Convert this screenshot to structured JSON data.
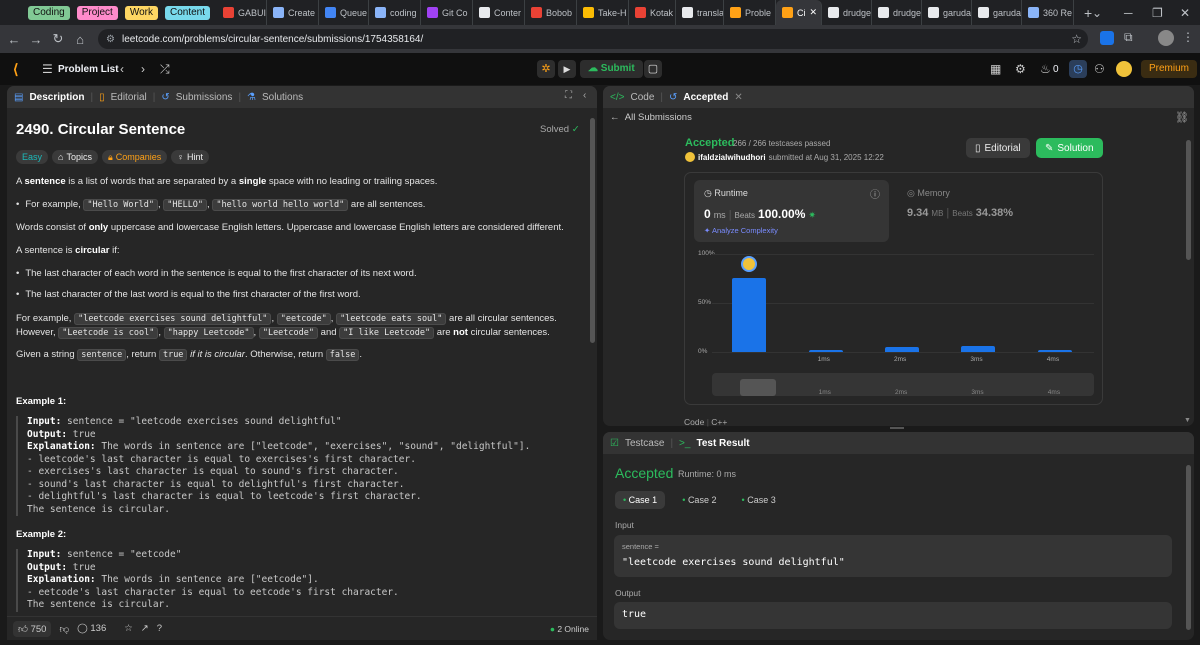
{
  "tab_groups": [
    {
      "label": "Coding",
      "color": "#81c995"
    },
    {
      "label": "Project",
      "color": "#ff8bcb"
    },
    {
      "label": "Work",
      "color": "#fdd663"
    },
    {
      "label": "Content",
      "color": "#78d9ec"
    }
  ],
  "tabs": [
    {
      "label": "GABUI",
      "icon": "gmail-icon",
      "color": "#e94235"
    },
    {
      "label": "Create",
      "icon": "chrome-icon",
      "color": "#8ab4f8"
    },
    {
      "label": "Queue",
      "icon": "queue-icon",
      "color": "#4285f4"
    },
    {
      "label": "coding",
      "icon": "coding-icon",
      "color": "#8ab4f8"
    },
    {
      "label": "Git Co",
      "icon": "heart-icon",
      "color": "#a142f4"
    },
    {
      "label": "Conter",
      "icon": "doc-icon",
      "color": "#e8eaed"
    },
    {
      "label": "Bobob",
      "icon": "gmail-icon",
      "color": "#e94235"
    },
    {
      "label": "Take-H",
      "icon": "drive-icon",
      "color": "#fbbc04"
    },
    {
      "label": "Kotak",
      "icon": "gmail-icon",
      "color": "#e94235"
    },
    {
      "label": "transla",
      "icon": "google-icon",
      "color": "#e8eaed"
    },
    {
      "label": "Proble",
      "icon": "leetcode-icon",
      "color": "#ffa116"
    },
    {
      "label": "Ci",
      "icon": "leetcode-icon",
      "color": "#ffa116"
    },
    {
      "label": "drudge",
      "icon": "github-icon",
      "color": "#e8eaed"
    },
    {
      "label": "drudge",
      "icon": "github-icon",
      "color": "#e8eaed"
    },
    {
      "label": "garuda",
      "icon": "github-icon",
      "color": "#e8eaed"
    },
    {
      "label": "garuda",
      "icon": "github-icon",
      "color": "#e8eaed"
    },
    {
      "label": "360 Re",
      "icon": "calendar-icon",
      "color": "#8ab4f8"
    }
  ],
  "browser": {
    "url": "leetcode.com/problems/circular-sentence/submissions/1754358164/"
  },
  "topbar": {
    "problem_list": "Problem List",
    "submit": "Submit",
    "streak": "0",
    "premium": "Premium"
  },
  "left": {
    "tabs": [
      "Description",
      "Editorial",
      "Submissions",
      "Solutions"
    ],
    "title": "2490. Circular Sentence",
    "solved": "Solved",
    "tags": [
      "Easy",
      "Topics",
      "Companies",
      "Hint"
    ],
    "p1": {
      "a": "A ",
      "b": "sentence",
      "c": " is a list of words that are separated by a ",
      "d": "single",
      "e": " space with no leading or trailing spaces."
    },
    "li1": {
      "a": "For example, ",
      "c1": "\"Hello World\"",
      "s1": ", ",
      "c2": "\"HELLO\"",
      "s2": ", ",
      "c3": "\"hello world hello world\"",
      "e": " are all sentences."
    },
    "p2": {
      "a": "Words consist of ",
      "b": "only",
      "c": " uppercase and lowercase English letters. Uppercase and lowercase English letters are considered different."
    },
    "p3": {
      "a": "A sentence is ",
      "b": "circular",
      "c": " if:"
    },
    "li2": "The last character of each word in the sentence is equal to the first character of its next word.",
    "li3": "The last character of the last word is equal to the first character of the first word.",
    "p4": {
      "a": "For example, ",
      "c1": "\"leetcode exercises sound delightful\"",
      "s1": ", ",
      "c2": "\"eetcode\"",
      "s2": ", ",
      "c3": "\"leetcode eats soul\"",
      "s3": " are all circular sentences. However, ",
      "c4": "\"Leetcode is cool\"",
      "s4": ", ",
      "c5": "\"happy Leetcode\"",
      "s5": ", ",
      "c6": "\"Leetcode\"",
      "s6": " and ",
      "c7": "\"I like Leetcode\"",
      "s7": " are ",
      "b": "not",
      "e": " circular sentences."
    },
    "p5": {
      "a": "Given a string ",
      "c1": "sentence",
      "s1": ", return ",
      "c2": "true",
      "i": " if it is circular",
      "s2": ". Otherwise, return ",
      "c3": "false",
      "e": "."
    },
    "ex1_title": "Example 1:",
    "ex1": {
      "in_k": "Input:",
      "in_v": " sentence = \"leetcode exercises sound delightful\"",
      "out_k": "Output:",
      "out_v": " true",
      "exp_k": "Explanation:",
      "exp_v": " The words in sentence are [\"leetcode\", \"exercises\", \"sound\", \"delightful\"].",
      "l1": "- leetcode's last character is equal to exercises's first character.",
      "l2": "- exercises's last character is equal to sound's first character.",
      "l3": "- sound's last character is equal to delightful's first character.",
      "l4": "- delightful's last character is equal to leetcode's first character.",
      "l5": "The sentence is circular."
    },
    "ex2_title": "Example 2:",
    "ex2": {
      "in_k": "Input:",
      "in_v": " sentence = \"eetcode\"",
      "out_k": "Output:",
      "out_v": " true",
      "exp_k": "Explanation:",
      "exp_v": " The words in sentence are [\"eetcode\"].",
      "l1": "- eetcode's last character is equal to eetcode's first character.",
      "l2": "The sentence is circular."
    },
    "footer": {
      "likes": "750",
      "comments": "136",
      "online": "2 Online"
    }
  },
  "right": {
    "tabs": [
      "Code",
      "Accepted"
    ],
    "all_submissions": "All Submissions",
    "status": "Accepted",
    "passed": "266 / 266 testcases passed",
    "user": "ifaldzialwihudhori",
    "submitted": "submitted at Aug 31, 2025 12:22",
    "editorial_btn": "Editorial",
    "solution_btn": "Solution",
    "runtime": {
      "label": "Runtime",
      "value": "0",
      "unit": "ms",
      "beats_label": "Beats",
      "beats": "100.00%",
      "analyze": "Analyze Complexity"
    },
    "memory": {
      "label": "Memory",
      "value": "9.34",
      "unit": "MB",
      "beats_label": "Beats",
      "beats": "34.38%"
    },
    "code_lang": {
      "label": "Code",
      "lang": "C++"
    }
  },
  "chart_data": {
    "type": "bar",
    "categories": [
      "0ms",
      "1ms",
      "2ms",
      "3ms",
      "4ms"
    ],
    "tick_labels": [
      "",
      "1ms",
      "2ms",
      "3ms",
      "4ms"
    ],
    "values": [
      76,
      2,
      5,
      6,
      2
    ],
    "ylim": [
      0,
      100
    ],
    "y_ticks": [
      "100%",
      "50%",
      "0%"
    ],
    "colors": {
      "bar": "#1a73e8"
    },
    "grid": true
  },
  "bottom": {
    "tabs": [
      "Testcase",
      "Test Result"
    ],
    "status": "Accepted",
    "runtime": "Runtime: 0 ms",
    "cases": [
      "Case 1",
      "Case 2",
      "Case 3"
    ],
    "input_label": "Input",
    "var": "sentence =",
    "input_value": "\"leetcode exercises sound delightful\"",
    "output_label": "Output",
    "output_value": "true"
  }
}
